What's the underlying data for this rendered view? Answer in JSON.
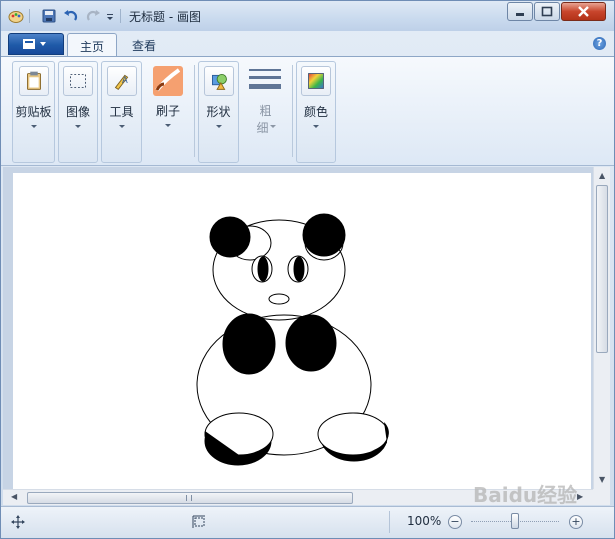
{
  "window": {
    "title": "无标题 - 画图"
  },
  "tabs": [
    {
      "label": "主页",
      "active": true
    },
    {
      "label": "查看",
      "active": false
    }
  ],
  "ribbon": {
    "clipboard": "剪贴板",
    "image": "图像",
    "tools": "工具",
    "brushes": "刷子",
    "shapes": "形状",
    "size_line1": "粗",
    "size_line2": "细",
    "colors": "颜色"
  },
  "status": {
    "zoom": "100%",
    "zoom_level_percent": 100
  },
  "colors": {
    "ribbon_blue": "#1f5aa8",
    "canvas_bg": "#ffffff",
    "workspace_bg": "#c7d4e5"
  },
  "icons": [
    "paint-app-icon",
    "save-icon",
    "undo-icon",
    "redo-icon",
    "qat-dropdown-icon",
    "minimize-icon",
    "maximize-icon",
    "close-icon",
    "help-icon",
    "clipboard-icon",
    "select-icon",
    "tools-icon",
    "brush-icon",
    "shapes-icon",
    "size-icon",
    "colors-icon",
    "move-cursor-icon",
    "selection-size-icon",
    "zoom-out-icon",
    "zoom-in-icon"
  ],
  "watermark": "Baidu经验"
}
